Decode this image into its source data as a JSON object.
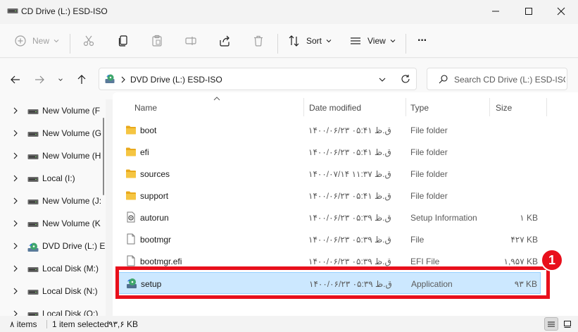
{
  "window": {
    "title": "CD Drive (L:) ESD-ISO"
  },
  "toolbar": {
    "new_label": "New",
    "sort_label": "Sort",
    "view_label": "View",
    "more_label": "···"
  },
  "address": {
    "path": "DVD Drive (L:) ESD-ISO",
    "search_placeholder": "Search CD Drive (L:) ESD-ISO"
  },
  "nav_pane": {
    "items": [
      {
        "label": "New Volume (F",
        "icon": "drive-icon"
      },
      {
        "label": "New Volume (G",
        "icon": "drive-icon"
      },
      {
        "label": "New Volume (H",
        "icon": "drive-icon"
      },
      {
        "label": "Local  (I:)",
        "icon": "drive-icon"
      },
      {
        "label": "New Volume (J:",
        "icon": "drive-icon"
      },
      {
        "label": "New Volume (K",
        "icon": "drive-icon"
      },
      {
        "label": "DVD Drive (L:) E",
        "icon": "dvd-drive-icon"
      },
      {
        "label": "Local Disk (M:)",
        "icon": "drive-icon"
      },
      {
        "label": "Local Disk (N:)",
        "icon": "drive-icon"
      },
      {
        "label": "Local Disk (O:)",
        "icon": "drive-icon"
      }
    ]
  },
  "columns": {
    "name": "Name",
    "date": "Date modified",
    "type": "Type",
    "size": "Size"
  },
  "files": [
    {
      "name": "boot",
      "date": "۱۴۰۰/۰۶/۲۳ ق.ظ ۰۵:۴۱",
      "type": "File folder",
      "size": "",
      "icon": "folder-icon"
    },
    {
      "name": "efi",
      "date": "۱۴۰۰/۰۶/۲۳ ق.ظ ۰۵:۴۱",
      "type": "File folder",
      "size": "",
      "icon": "folder-icon"
    },
    {
      "name": "sources",
      "date": "۱۴۰۰/۰۷/۱۴ ق.ظ ۱۱:۳۷",
      "type": "File folder",
      "size": "",
      "icon": "folder-icon"
    },
    {
      "name": "support",
      "date": "۱۴۰۰/۰۶/۲۳ ق.ظ ۰۵:۴۱",
      "type": "File folder",
      "size": "",
      "icon": "folder-icon"
    },
    {
      "name": "autorun",
      "date": "۱۴۰۰/۰۶/۲۳ ق.ظ ۰۵:۳۹",
      "type": "Setup Information",
      "size": "۱ KB",
      "icon": "settings-file-icon"
    },
    {
      "name": "bootmgr",
      "date": "۱۴۰۰/۰۶/۲۳ ق.ظ ۰۵:۳۹",
      "type": "File",
      "size": "۴۲۷ KB",
      "icon": "file-icon"
    },
    {
      "name": "bootmgr.efi",
      "date": "۱۴۰۰/۰۶/۲۳ ق.ظ ۰۵:۳۹",
      "type": "EFI File",
      "size": "۱,۹۵۷ KB",
      "icon": "file-icon"
    },
    {
      "name": "setup",
      "date": "۱۴۰۰/۰۶/۲۳ ق.ظ ۰۵:۳۹",
      "type": "Application",
      "size": "۹۳ KB",
      "icon": "setup-app-icon",
      "selected": true
    }
  ],
  "annotation": {
    "badge": "1",
    "color": "#e8101c"
  },
  "status": {
    "item_count": "۸ items",
    "selected": "1 item selected",
    "selected_size": "۹۳,۶ KB"
  },
  "colors": {
    "accent": "#0067c0",
    "selection_bg": "#cce8ff",
    "folder": "#f5c542"
  }
}
